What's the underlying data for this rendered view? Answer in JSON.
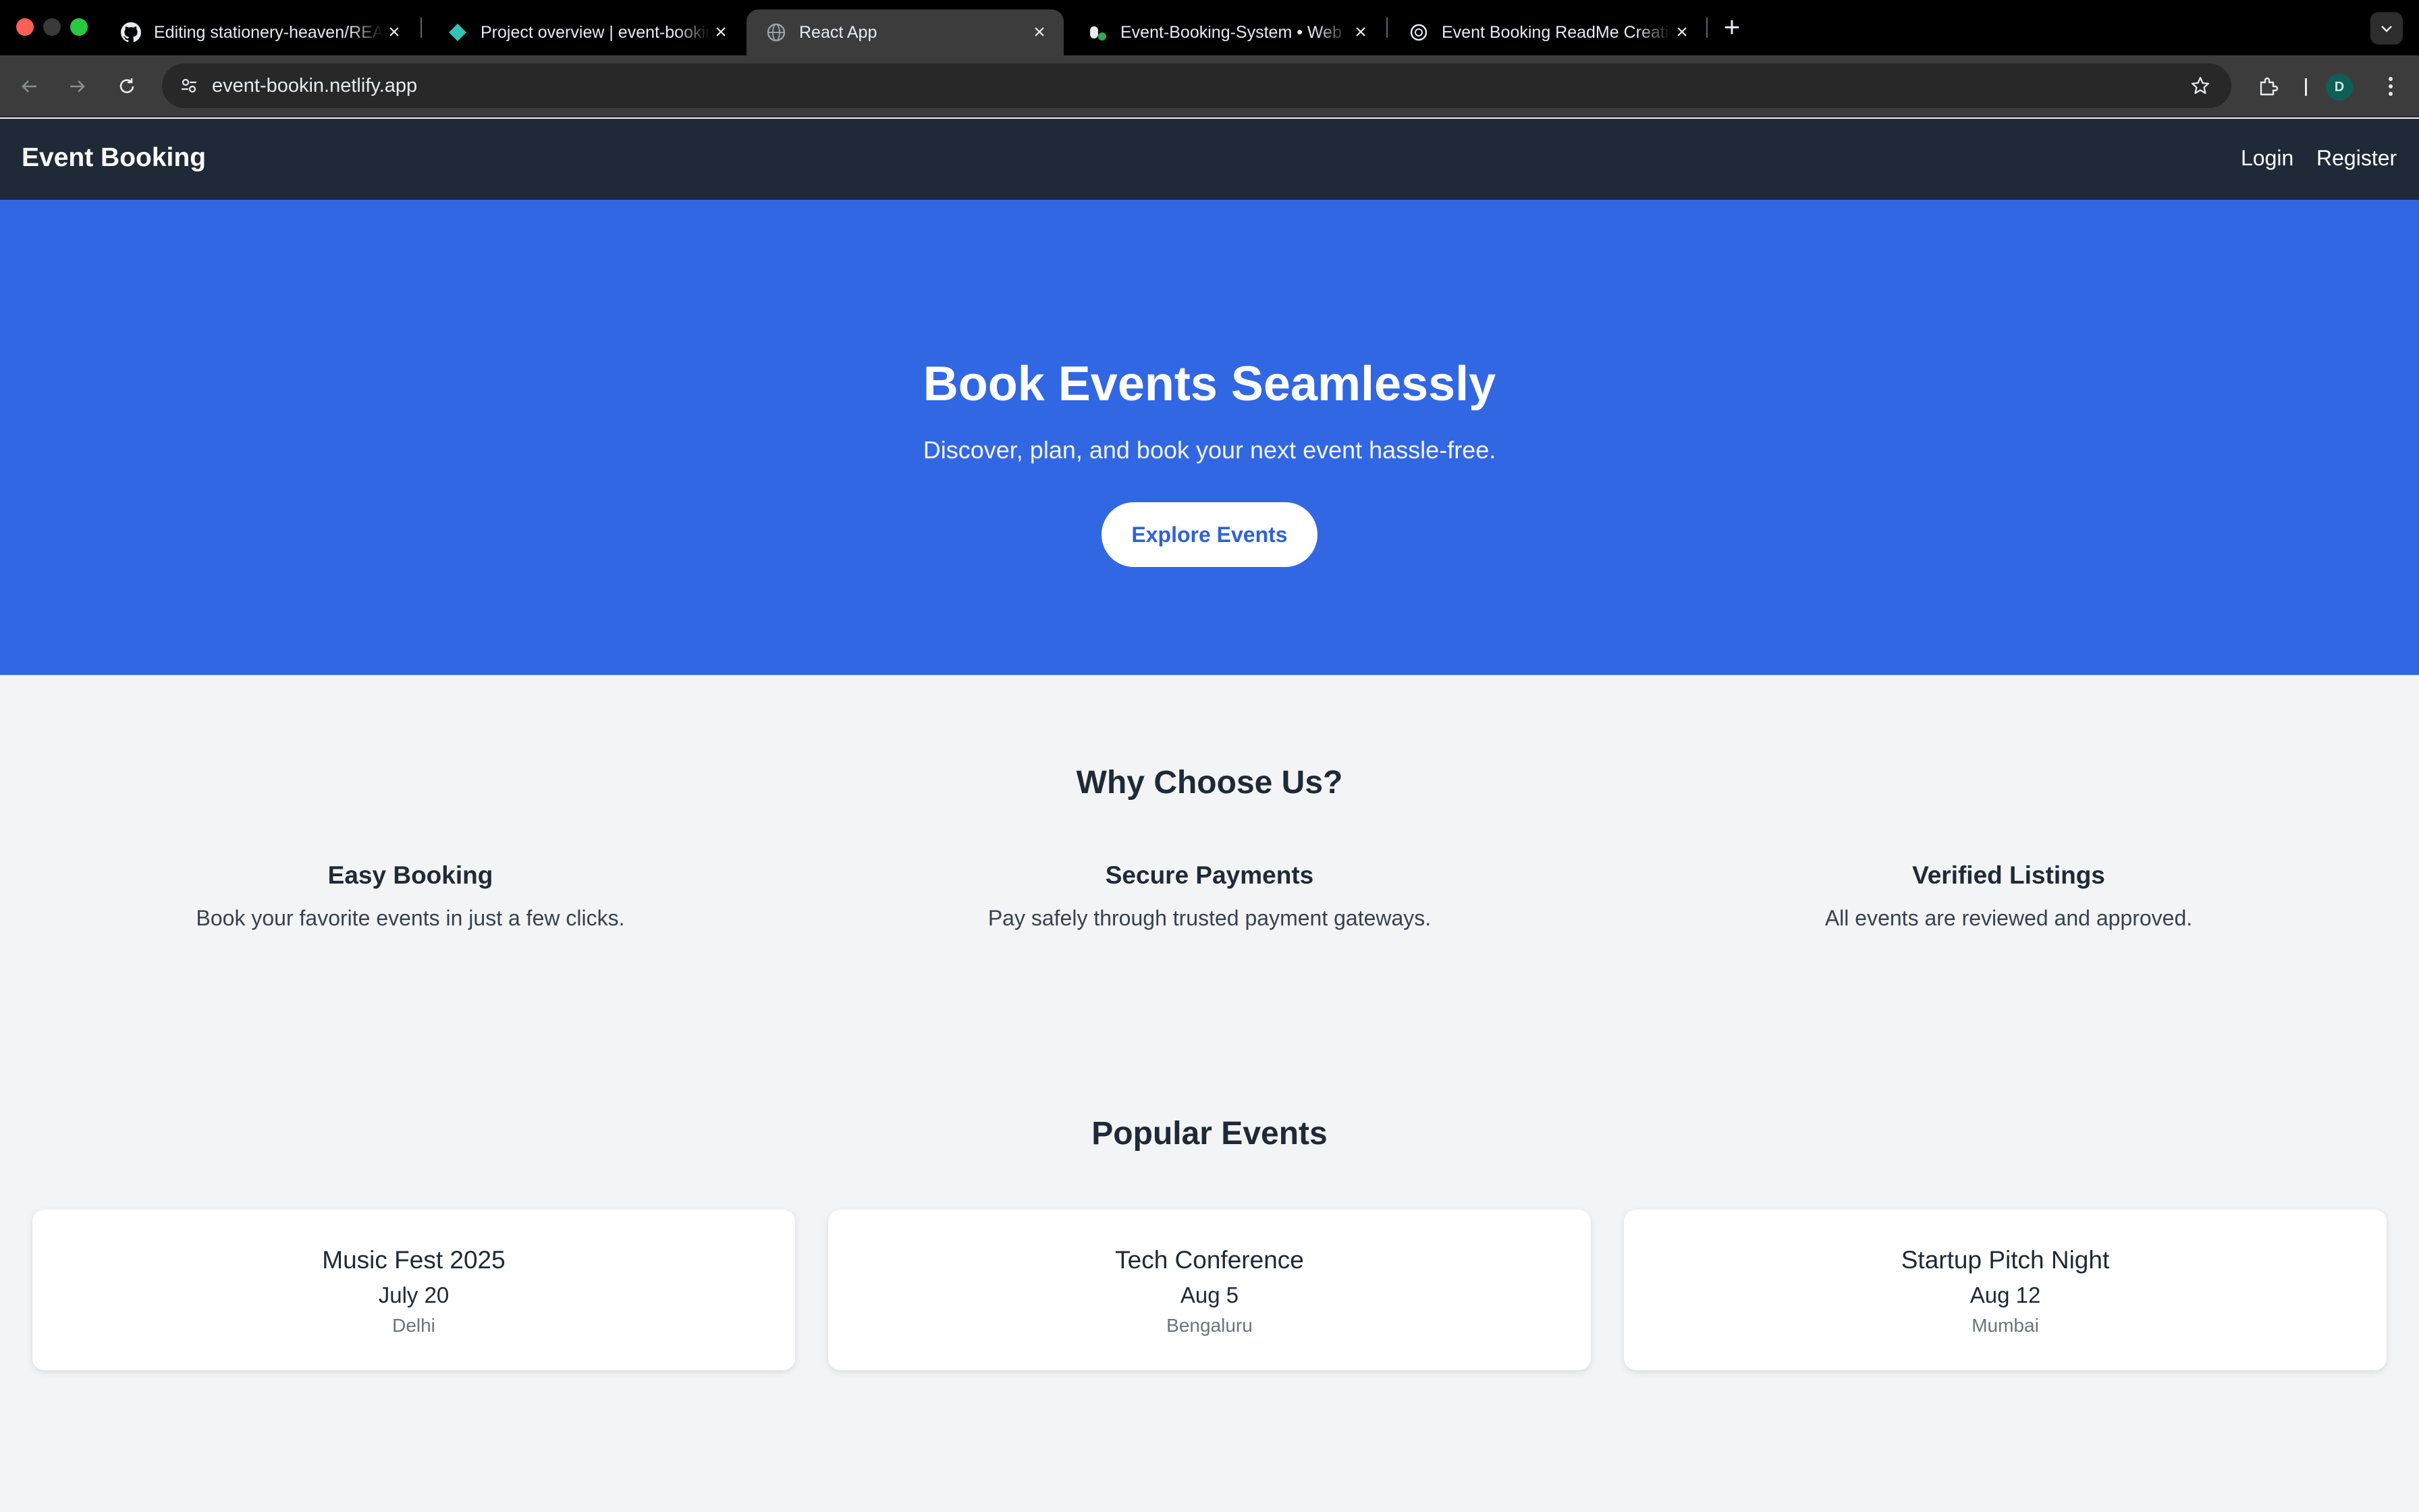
{
  "browser": {
    "tabs": [
      {
        "title": "Editing stationery-heaven/README.md",
        "icon": "github-icon",
        "active": false
      },
      {
        "title": "Project overview | event-booking",
        "icon": "netlify-icon",
        "active": false
      },
      {
        "title": "React App",
        "icon": "globe-icon",
        "active": true
      },
      {
        "title": "Event-Booking-System • Web",
        "icon": "render-icon",
        "active": false
      },
      {
        "title": "Event Booking ReadMe Creation",
        "icon": "openai-icon",
        "active": false
      }
    ],
    "url": "event-bookin.netlify.app",
    "profile_initial": "D"
  },
  "site": {
    "brand": "Event Booking",
    "nav": {
      "login": "Login",
      "register": "Register"
    },
    "hero": {
      "title": "Book Events Seamlessly",
      "subtitle": "Discover, plan, and book your next event hassle-free.",
      "cta": "Explore Events",
      "background": "#3267e3"
    },
    "why": {
      "title": "Why Choose Us?",
      "features": [
        {
          "title": "Easy Booking",
          "text": "Book your favorite events in just a few clicks."
        },
        {
          "title": "Secure Payments",
          "text": "Pay safely through trusted payment gateways."
        },
        {
          "title": "Verified Listings",
          "text": "All events are reviewed and approved."
        }
      ]
    },
    "popular": {
      "title": "Popular Events",
      "events": [
        {
          "name": "Music Fest 2025",
          "date": "July 20",
          "city": "Delhi"
        },
        {
          "name": "Tech Conference",
          "date": "Aug 5",
          "city": "Bengaluru"
        },
        {
          "name": "Startup Pitch Night",
          "date": "Aug 12",
          "city": "Mumbai"
        }
      ]
    }
  }
}
